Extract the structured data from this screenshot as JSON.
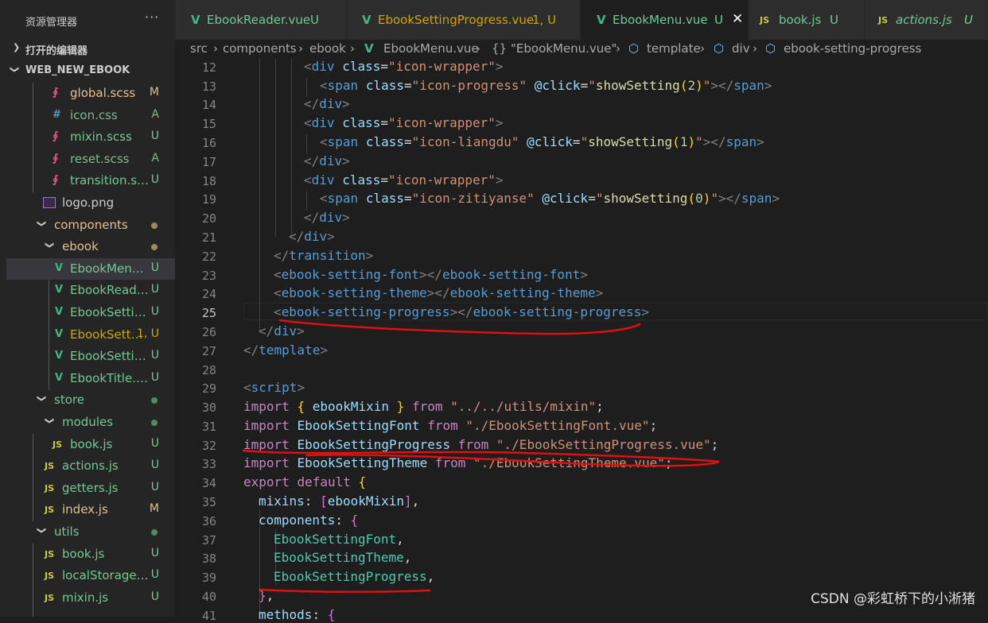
{
  "explorer": {
    "title": "资源管理器",
    "more": "···",
    "open_editors": "打开的编辑器",
    "project": "WEB_NEW_EBOOK"
  },
  "tree": [
    {
      "name": "global.scss",
      "icon": "sass-icon",
      "badge": "M"
    },
    {
      "name": "icon.css",
      "icon": "css-icon",
      "badge": "A"
    },
    {
      "name": "mixin.scss",
      "icon": "sass-icon",
      "badge": "U"
    },
    {
      "name": "reset.scss",
      "icon": "sass-icon",
      "badge": "A"
    },
    {
      "name": "transition.scss",
      "icon": "sass-icon",
      "badge": "U"
    },
    {
      "name": "logo.png",
      "icon": "image-icon",
      "badge": ""
    },
    {
      "name": "components",
      "icon": "folder",
      "badge": ""
    },
    {
      "name": "ebook",
      "icon": "folder",
      "badge": ""
    },
    {
      "name": "EbookMenu....",
      "icon": "vue-icon",
      "badge": "U"
    },
    {
      "name": "EbookReade...",
      "icon": "vue-icon",
      "badge": "U"
    },
    {
      "name": "EbookSettin...",
      "icon": "vue-icon",
      "badge": "U"
    },
    {
      "name": "EbookSetti...",
      "icon": "vue-icon",
      "badge": "1, U"
    },
    {
      "name": "EbookSettin...",
      "icon": "vue-icon",
      "badge": "U"
    },
    {
      "name": "EbookTitle.v...",
      "icon": "vue-icon",
      "badge": "U"
    },
    {
      "name": "store",
      "icon": "folder",
      "badge": ""
    },
    {
      "name": "modules",
      "icon": "folder",
      "badge": ""
    },
    {
      "name": "book.js",
      "icon": "js-icon",
      "badge": "U"
    },
    {
      "name": "actions.js",
      "icon": "js-icon",
      "badge": "U"
    },
    {
      "name": "getters.js",
      "icon": "js-icon",
      "badge": "U"
    },
    {
      "name": "index.js",
      "icon": "js-icon",
      "badge": "M"
    },
    {
      "name": "utils",
      "icon": "folder",
      "badge": ""
    },
    {
      "name": "book.js",
      "icon": "js-icon",
      "badge": "U"
    },
    {
      "name": "localStorage.js",
      "icon": "js-icon",
      "badge": "U"
    },
    {
      "name": "mixin.js",
      "icon": "js-icon",
      "badge": "U"
    }
  ],
  "tabs": [
    {
      "name": "EbookReader.vue",
      "badge": "U",
      "icon": "vue-icon"
    },
    {
      "name": "EbookSettingProgress.vue",
      "badge": "1, U",
      "icon": "vue-icon"
    },
    {
      "name": "EbookMenu.vue",
      "badge": "U",
      "icon": "vue-icon",
      "close": "✕"
    },
    {
      "name": "book.js",
      "badge": "U",
      "icon": "js-icon",
      "glyph": "JS"
    },
    {
      "name": "actions.js",
      "badge": "U",
      "icon": "js-icon",
      "glyph": "JS"
    }
  ],
  "breadcrumb": {
    "src": "src",
    "components": "components",
    "ebook": "ebook",
    "file": "EbookMenu.vue",
    "braces": "{}",
    "sfc": "\"EbookMenu.vue\"",
    "template": "template",
    "div": "div",
    "last": "ebook-setting-progress",
    "sep": "›"
  },
  "line_numbers": [
    "12",
    "13",
    "14",
    "15",
    "16",
    "17",
    "18",
    "19",
    "20",
    "21",
    "22",
    "23",
    "24",
    "25",
    "26",
    "27",
    "28",
    "29",
    "30",
    "31",
    "32",
    "33",
    "34",
    "35",
    "36",
    "37",
    "38",
    "39",
    "40",
    "41"
  ],
  "code": {
    "l12": {
      "o": "<",
      "tag": "div",
      "sp": " ",
      "attr": "class",
      "eq": "=",
      "val": "\"icon-wrapper\"",
      "c": ">"
    },
    "l13": {
      "o": "<",
      "tag": "span",
      "sp": " ",
      "attr": "class",
      "eq": "=",
      "val": "\"icon-progress\"",
      "sp2": " ",
      "ev": "@click",
      "eq2": "=",
      "q1": "\"",
      "fn": "showSetting",
      "pa": "(",
      "num": "2",
      "pb": ")",
      "q2": "\"",
      "mid": "></",
      "tag2": "span",
      "c": ">"
    },
    "l14": {
      "o": "</",
      "tag": "div",
      "c": ">"
    },
    "l15": {
      "o": "<",
      "tag": "div",
      "sp": " ",
      "attr": "class",
      "eq": "=",
      "val": "\"icon-wrapper\"",
      "c": ">"
    },
    "l16": {
      "o": "<",
      "tag": "span",
      "sp": " ",
      "attr": "class",
      "eq": "=",
      "val": "\"icon-liangdu\"",
      "sp2": " ",
      "ev": "@click",
      "eq2": "=",
      "q1": "\"",
      "fn": "showSetting",
      "pa": "(",
      "num": "1",
      "pb": ")",
      "q2": "\"",
      "mid": "></",
      "tag2": "span",
      "c": ">"
    },
    "l17": {
      "o": "</",
      "tag": "div",
      "c": ">"
    },
    "l18": {
      "o": "<",
      "tag": "div",
      "sp": " ",
      "attr": "class",
      "eq": "=",
      "val": "\"icon-wrapper\"",
      "c": ">"
    },
    "l19": {
      "o": "<",
      "tag": "span",
      "sp": " ",
      "attr": "class",
      "eq": "=",
      "val": "\"icon-zitiyanse\"",
      "sp2": " ",
      "ev": "@click",
      "eq2": "=",
      "q1": "\"",
      "fn": "showSetting",
      "pa": "(",
      "num": "0",
      "pb": ")",
      "q2": "\"",
      "mid": "></",
      "tag2": "span",
      "c": ">"
    },
    "l20": {
      "o": "</",
      "tag": "div",
      "c": ">"
    },
    "l21": {
      "o": "</",
      "tag": "div",
      "c": ">"
    },
    "l22": {
      "o": "</",
      "tag": "transition",
      "c": ">"
    },
    "l23": {
      "o": "<",
      "tag": "ebook-setting-font",
      "mid": "></",
      "tag2": "ebook-setting-font",
      "c": ">"
    },
    "l24": {
      "o": "<",
      "tag": "ebook-setting-theme",
      "mid": "></",
      "tag2": "ebook-setting-theme",
      "c": ">"
    },
    "l25": {
      "o": "<",
      "tag": "ebook-setting-progress",
      "mid": "></",
      "tag2": "ebook-setting-progress",
      "c": ">"
    },
    "l26": {
      "o": "</",
      "tag": "div",
      "c": ">"
    },
    "l27": {
      "o": "</",
      "tag": "template",
      "c": ">"
    },
    "l29": {
      "o": "<",
      "tag": "script",
      "c": ">"
    },
    "l30": {
      "kw": "import",
      "sp": " ",
      "br": "{",
      "id": " ebookMixin ",
      "br2": "}",
      "sp2": " ",
      "from": "from",
      "sp3": " ",
      "str": "\"../../utils/mixin\"",
      "end": ";"
    },
    "l31": {
      "kw": "import",
      "sp": " ",
      "id": "EbookSettingFont",
      "sp2": " ",
      "from": "from",
      "sp3": " ",
      "str": "\"./EbookSettingFont.vue\"",
      "end": ";"
    },
    "l32": {
      "kw": "import",
      "sp": " ",
      "id": "EbookSettingProgress",
      "sp2": " ",
      "from": "from",
      "sp3": " ",
      "str": "\"./EbookSettingProgress.vue\"",
      "end": ";"
    },
    "l33": {
      "kw": "import",
      "sp": " ",
      "id": "EbookSettingTheme",
      "sp2": " ",
      "from": "from",
      "sp3": " ",
      "str": "\"./EbookSettingTheme.vue\"",
      "end": ";"
    },
    "l34": {
      "kw": "export",
      "sp": " ",
      "kw2": "default",
      "sp2": " ",
      "br": "{"
    },
    "l35": {
      "prop": "mixins",
      "colon": ": ",
      "br": "[",
      "id": "ebookMixin",
      "br2": "]",
      "end": ","
    },
    "l36": {
      "prop": "components",
      "colon": ": ",
      "br": "{"
    },
    "l37": {
      "id": "EbookSettingFont",
      "end": ","
    },
    "l38": {
      "id": "EbookSettingTheme",
      "end": ","
    },
    "l39": {
      "id": "EbookSettingProgress",
      "end": ","
    },
    "l40": {
      "br": "}",
      "end": ","
    },
    "l41": {
      "prop": "methods",
      "colon": ": ",
      "br": "{"
    }
  },
  "watermark": "CSDN @彩虹桥下的小淅猪",
  "colors": {
    "vue": "#41b883",
    "js": "#cbcb41",
    "sass": "#f55385",
    "css": "#519aba",
    "modified": "#e2c08d",
    "added": "#81b88b",
    "untracked": "#73c991",
    "warning": "#cca700",
    "annotation": "#e01010"
  }
}
